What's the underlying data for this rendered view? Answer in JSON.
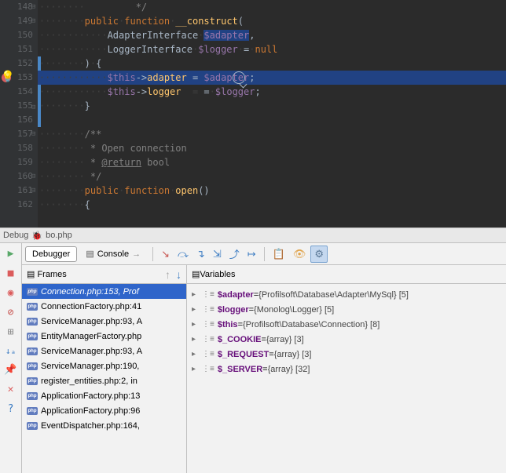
{
  "gutter": {
    "lines": [
      "148",
      "149",
      "150",
      "151",
      "152",
      "153",
      "154",
      "155",
      "156",
      "157",
      "158",
      "159",
      "160",
      "161",
      "162"
    ]
  },
  "code": {
    "l148": {
      "c": "         */"
    },
    "l149": {
      "kw1": "public",
      "kw2": "function",
      "id": "__construct",
      "p": "("
    },
    "l150": {
      "ty": "AdapterInterface",
      "va": "$adapter",
      "c": ","
    },
    "l151": {
      "ty": "LoggerInterface",
      "va": "$logger",
      "eq": "=",
      "kw": "null"
    },
    "l152": {
      "p": ")",
      "b": "{"
    },
    "l153": {
      "va1": "$this",
      "ar": "->",
      "prop": "adapter",
      "eq": " = ",
      "va2": "$adapter",
      "sc": ";"
    },
    "l154": {
      "va1": "$this",
      "ar": "->",
      "prop": "logger",
      "eq": "  = ",
      "va2": "$logger",
      "sc": ";"
    },
    "l155": {
      "b": "}"
    },
    "l157": {
      "c": "/**"
    },
    "l158": {
      "c": " * Open connection"
    },
    "l159": {
      "c1": " * ",
      "tag": "@return",
      "c2": " bool"
    },
    "l160": {
      "c": " */"
    },
    "l161": {
      "kw1": "public",
      "kw2": "function",
      "id": "open",
      "p": "()"
    },
    "l162": {
      "b": "{"
    }
  },
  "tabs": {
    "debug": "Debug",
    "file": "bo.php"
  },
  "toolbar": {
    "debugger": "Debugger",
    "console": "Console"
  },
  "frames": {
    "title": "Frames",
    "items": [
      {
        "t": "Connection.php:153, Prof"
      },
      {
        "t": "ConnectionFactory.php:41"
      },
      {
        "t": "ServiceManager.php:93, A"
      },
      {
        "t": "EntityManagerFactory.php"
      },
      {
        "t": "ServiceManager.php:93, A"
      },
      {
        "t": "ServiceManager.php:190,"
      },
      {
        "t": "register_entities.php:2, in"
      },
      {
        "t": "ApplicationFactory.php:13"
      },
      {
        "t": "ApplicationFactory.php:96"
      },
      {
        "t": "EventDispatcher.php:164,"
      }
    ]
  },
  "vars": {
    "title": "Variables",
    "items": [
      {
        "n": "$adapter",
        "v": "{Profilsoft\\Database\\Adapter\\MySql} [5]"
      },
      {
        "n": "$logger",
        "v": "{Monolog\\Logger} [5]"
      },
      {
        "n": "$this",
        "v": "{Profilsoft\\Database\\Connection} [8]"
      },
      {
        "n": "$_COOKIE",
        "v": "{array} [3]"
      },
      {
        "n": "$_REQUEST",
        "v": "{array} [3]"
      },
      {
        "n": "$_SERVER",
        "v": "{array} [32]"
      }
    ]
  }
}
